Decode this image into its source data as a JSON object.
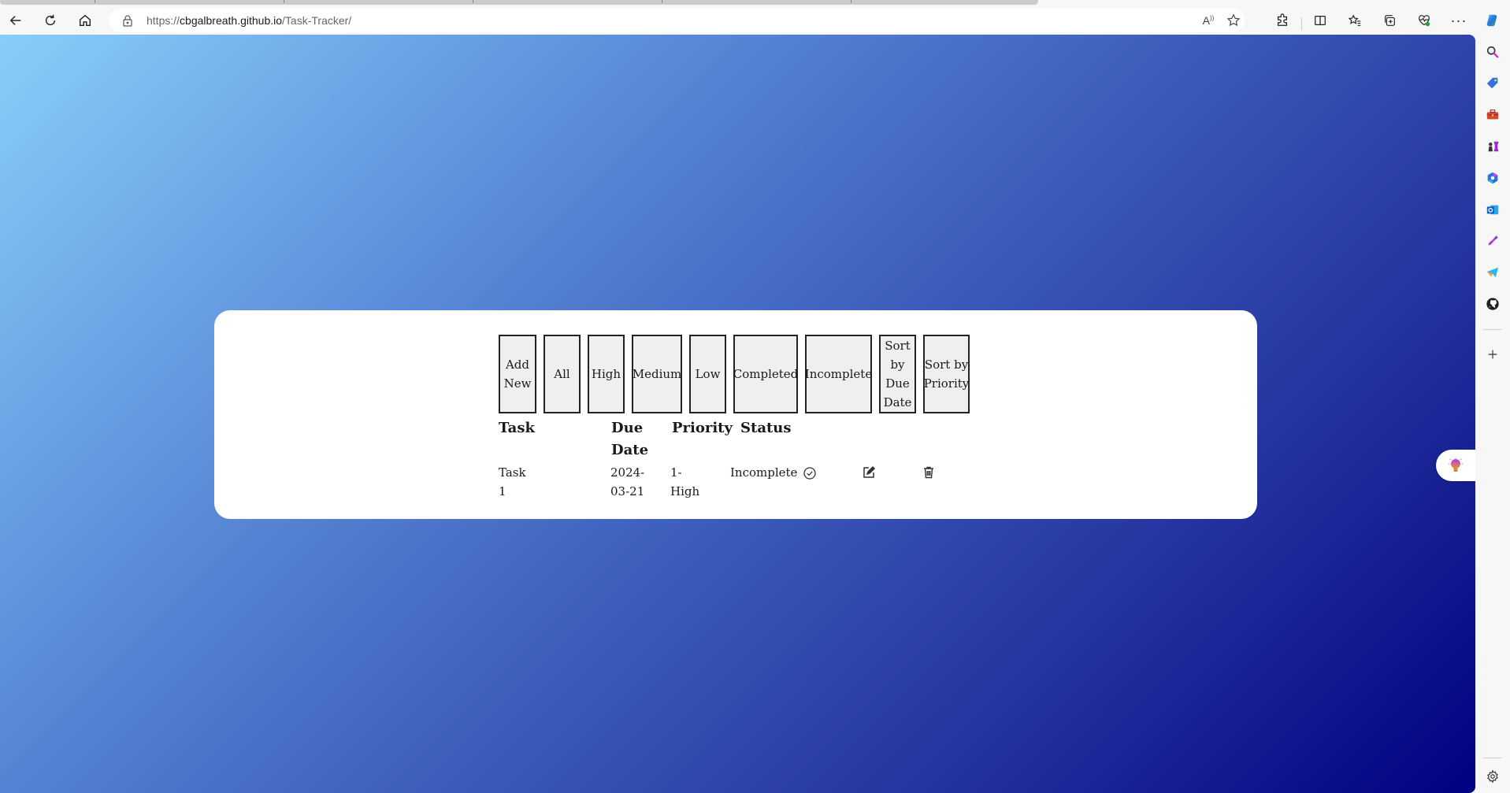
{
  "browser": {
    "url_scheme": "https://",
    "url_host": "cbgalbreath.github.io",
    "url_path": "/Task-Tracker/",
    "nav": {
      "back_icon": "arrow-left-icon",
      "refresh_icon": "refresh-icon",
      "home_icon": "home-icon",
      "lock_icon": "lock-icon"
    },
    "address_bar_icons": [
      "read-aloud-icon",
      "favorite-star-icon"
    ],
    "toolbar_icons": [
      "extensions-icon",
      "split-screen-icon",
      "favorites-icon",
      "collections-icon",
      "browser-essentials-icon",
      "more-icon",
      "copilot-icon"
    ],
    "sidebar_icons": [
      "search-icon",
      "shopping-tag-icon",
      "tools-icon",
      "games-icon",
      "microsoft-365-icon",
      "outlook-icon",
      "designer-icon",
      "telegram-icon",
      "github-icon",
      "add-icon",
      "settings-icon"
    ]
  },
  "app": {
    "buttons": [
      {
        "label": "Add New"
      },
      {
        "label": "All"
      },
      {
        "label": "High"
      },
      {
        "label": "Medium"
      },
      {
        "label": "Low"
      },
      {
        "label": "Completed"
      },
      {
        "label": "Incomplete"
      },
      {
        "label": "Sort by Due Date"
      },
      {
        "label": "Sort by Priority"
      }
    ],
    "table": {
      "headers": {
        "task": "Task",
        "due_date": "Due Date",
        "priority": "Priority",
        "status": "Status"
      },
      "rows": [
        {
          "task": "Task 1",
          "due_date": "2024-03-21",
          "priority": "1-High",
          "status": "Incomplete",
          "actions": [
            "mark-complete-icon",
            "edit-icon",
            "delete-icon"
          ]
        }
      ]
    }
  },
  "floating_pill_icon": "lightbulb-icon",
  "colors": {
    "gradient_start": "#87cefa",
    "gradient_end": "#000080",
    "card": "#ffffff",
    "button_bg": "#efefef",
    "button_border": "#222222"
  }
}
